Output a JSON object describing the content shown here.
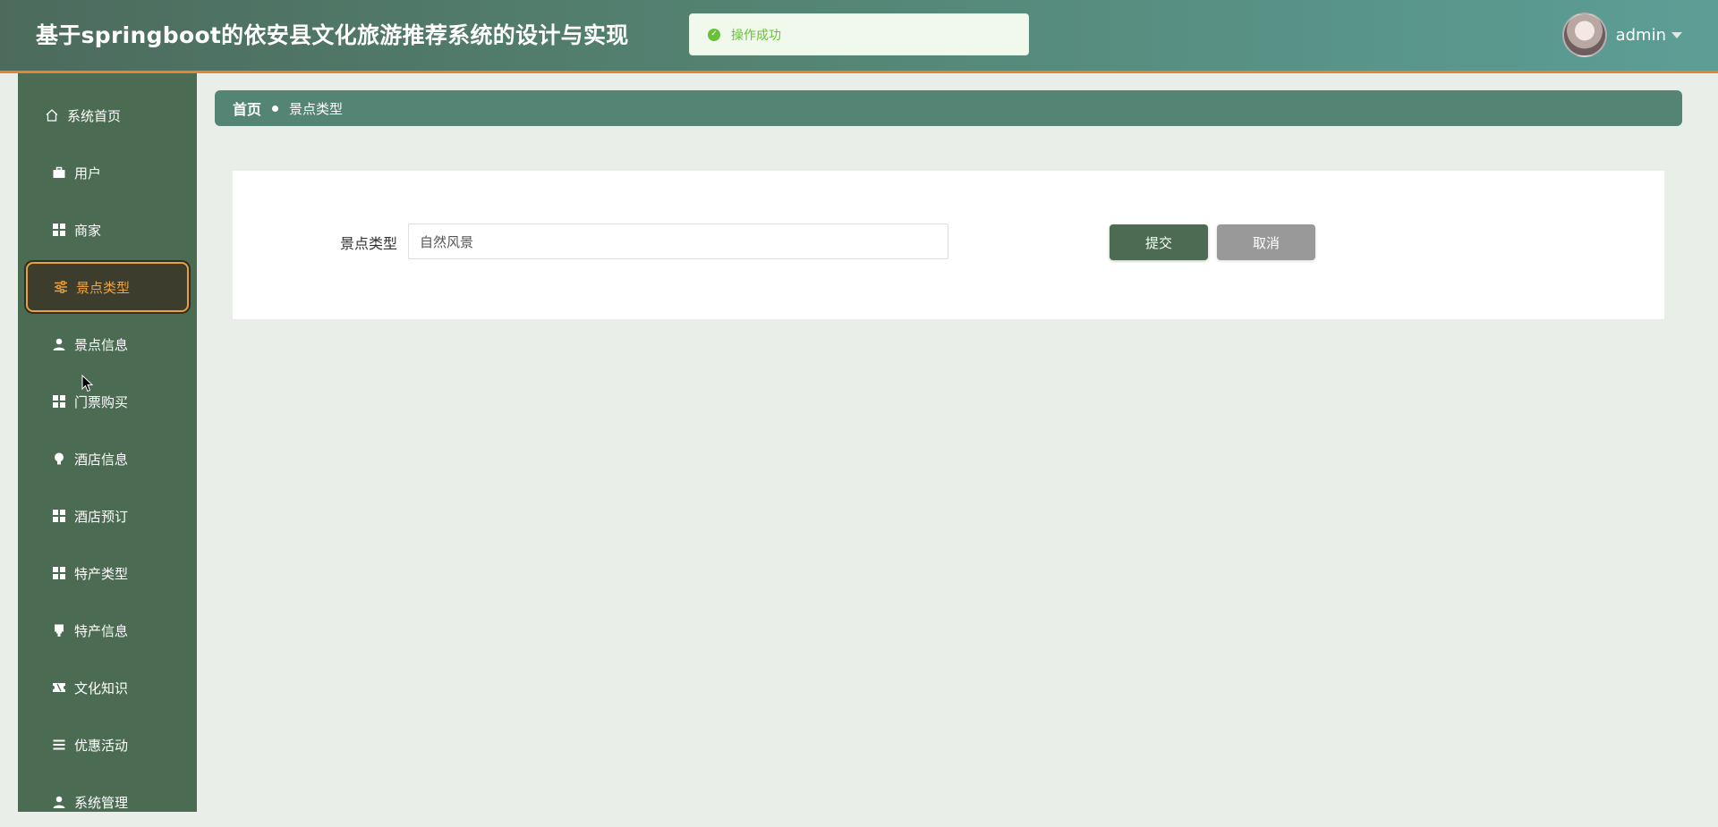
{
  "header": {
    "title": "基于springboot的依安县文化旅游推荐系统的设计与实现",
    "toast": "操作成功",
    "username": "admin"
  },
  "sidebar": {
    "items": [
      {
        "label": "系统首页",
        "icon": "home-icon"
      },
      {
        "label": "用户",
        "icon": "briefcase-icon"
      },
      {
        "label": "商家",
        "icon": "grid-icon"
      },
      {
        "label": "景点类型",
        "icon": "sliders-icon",
        "active": true
      },
      {
        "label": "景点信息",
        "icon": "person-icon"
      },
      {
        "label": "门票购买",
        "icon": "grid-icon"
      },
      {
        "label": "酒店信息",
        "icon": "lightbulb-icon"
      },
      {
        "label": "酒店预订",
        "icon": "grid-icon"
      },
      {
        "label": "特产类型",
        "icon": "grid-icon"
      },
      {
        "label": "特产信息",
        "icon": "stamp-icon"
      },
      {
        "label": "文化知识",
        "icon": "ticket-icon"
      },
      {
        "label": "优惠活动",
        "icon": "list-icon"
      },
      {
        "label": "系统管理",
        "icon": "person-icon"
      }
    ]
  },
  "breadcrumb": {
    "home": "首页",
    "current": "景点类型"
  },
  "form": {
    "label": "景点类型",
    "value": "自然风景",
    "submit_label": "提交",
    "cancel_label": "取消"
  },
  "colors": {
    "sidebar_bg": "#4b6b53",
    "active_border": "#e8a23d",
    "active_text": "#f0a43e",
    "success": "#67c23a",
    "header_accent": "#e8832f"
  }
}
